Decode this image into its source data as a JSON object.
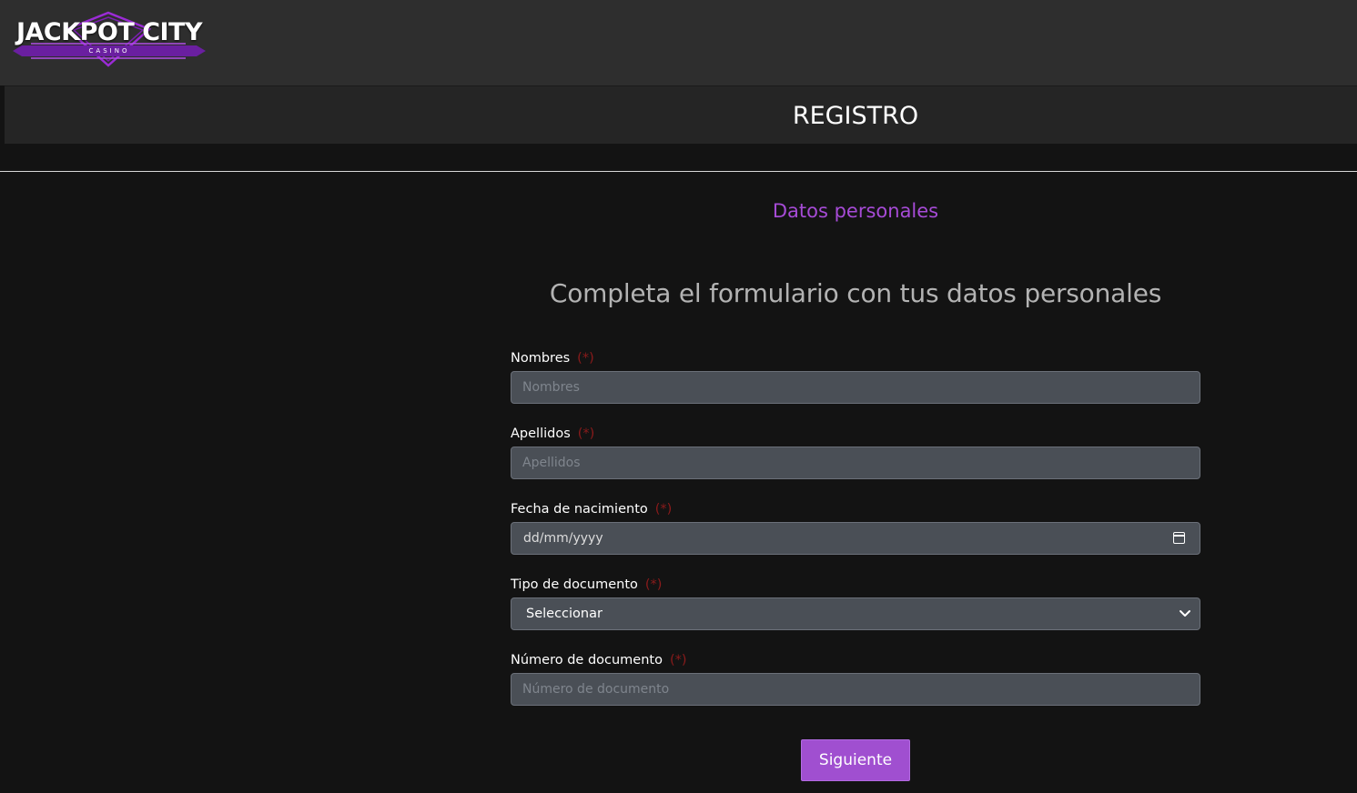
{
  "brand": {
    "name": "JACKPOT CITY",
    "subtitle": "CASINO",
    "accent_color": "#a64bd6"
  },
  "page": {
    "title": "REGISTRO",
    "step_label": "Datos personales",
    "heading": "Completa el formulario con tus datos personales"
  },
  "form": {
    "required_marker": "(*)",
    "fields": {
      "first_name": {
        "label": "Nombres",
        "placeholder": "Nombres",
        "value": ""
      },
      "last_name": {
        "label": "Apellidos",
        "placeholder": "Apellidos",
        "value": ""
      },
      "birth_date": {
        "label": "Fecha de nacimiento",
        "display": "dd/mm/yyyy",
        "icon": "calendar-icon"
      },
      "document_type": {
        "label": "Tipo de documento",
        "selected": "Seleccionar",
        "icon": "chevron-down-icon"
      },
      "document_number": {
        "label": "Número de documento",
        "placeholder": "Número de documento",
        "value": ""
      }
    },
    "submit_label": "Siguiente"
  }
}
